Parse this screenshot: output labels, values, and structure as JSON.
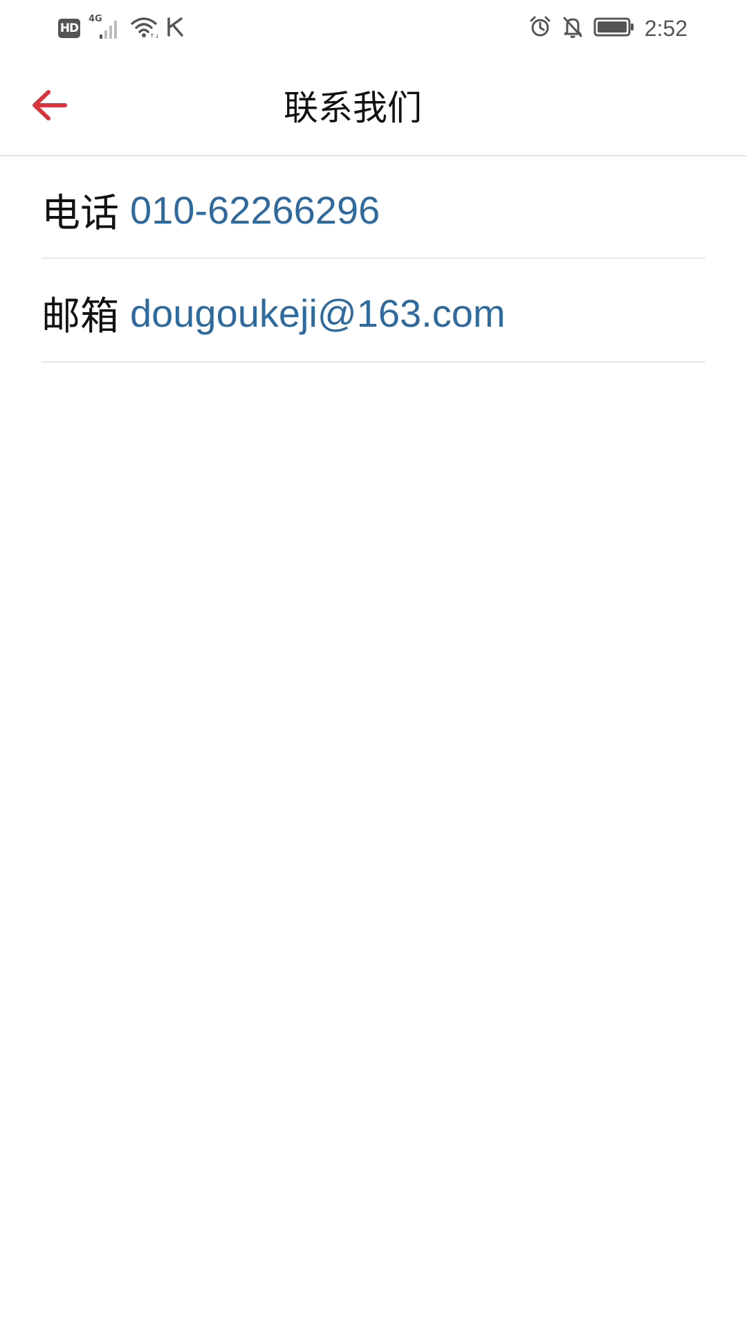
{
  "status_bar": {
    "hd": "HD",
    "network": "4G",
    "carrier_glyph": "K",
    "time": "2:52",
    "icons": [
      "hd-icon",
      "signal-icon",
      "wifi-icon",
      "k-icon",
      "alarm-icon",
      "bell-off-icon",
      "battery-icon"
    ]
  },
  "header": {
    "title": "联系我们",
    "back_icon": "arrow-left-icon",
    "accent_color": "#d9343d"
  },
  "contacts": [
    {
      "label": "电话",
      "value": "010-62266296"
    },
    {
      "label": "邮箱",
      "value": "dougoukeji@163.com"
    }
  ],
  "colors": {
    "link": "#2f6a9e",
    "divider": "#e6e6e6",
    "text": "#111111"
  }
}
